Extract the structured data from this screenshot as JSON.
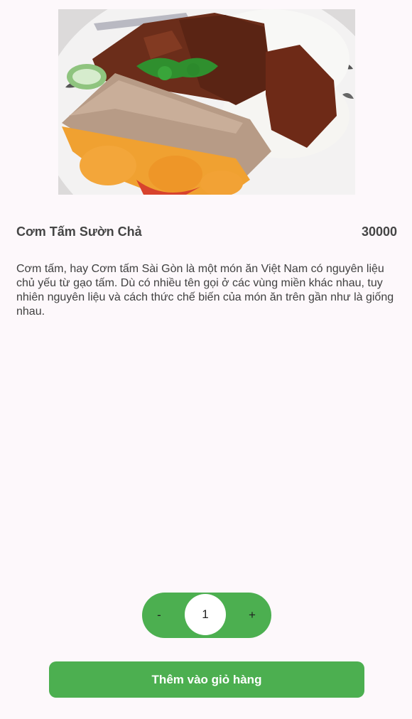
{
  "product": {
    "image_alt": "food-photo",
    "name": "Cơm Tấm Sườn Chả",
    "price": "30000",
    "description": "Cơm tấm, hay Cơm tấm Sài Gòn là một món ăn Việt Nam có nguyên liệu chủ yếu từ gạo tấm. Dù có nhiều tên gọi ở các vùng miền khác nhau, tuy nhiên nguyên liệu và cách thức chế biến của món ăn trên gần như là giống nhau."
  },
  "quantity": {
    "decrement_label": "-",
    "value": "1",
    "increment_label": "+"
  },
  "actions": {
    "add_to_cart_label": "Thêm vào giỏ hàng"
  },
  "colors": {
    "accent": "#4caf50",
    "background": "#fdf8fb"
  }
}
